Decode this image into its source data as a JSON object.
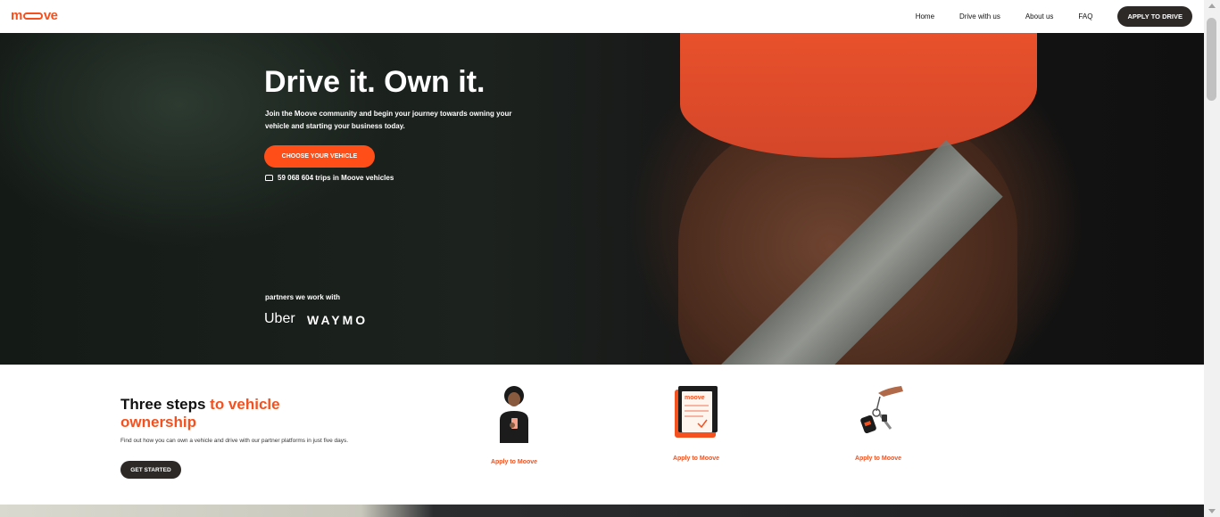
{
  "nav": {
    "logo_prefix": "m",
    "logo_suffix": "ve",
    "links": [
      "Home",
      "Drive with us",
      "About us",
      "FAQ"
    ],
    "cta": "APPLY TO DRIVE"
  },
  "hero": {
    "title": "Drive it. Own it.",
    "subtitle": "Join the Moove community and begin your journey towards owning your vehicle and starting your business today.",
    "cta": "CHOOSE YOUR VEHICLE",
    "trips": "59 068 604 trips in Moove vehicles",
    "partners_label": "partners we work with",
    "partners": [
      "Uber",
      "WAYMO"
    ]
  },
  "steps": {
    "title_plain": "Three steps ",
    "title_accent": "to vehicle ownership",
    "description": "Find out how you can own a vehicle and drive with our partner platforms in just five days.",
    "cta": "GET STARTED",
    "items": [
      {
        "link": "Apply to Moove",
        "icon": "person-phone-icon"
      },
      {
        "link": "Apply to Moove",
        "icon": "document-icon"
      },
      {
        "link": "Apply to Moove",
        "icon": "car-keys-icon"
      }
    ]
  },
  "colors": {
    "accent": "#f4511e",
    "dark": "#2d2926"
  }
}
